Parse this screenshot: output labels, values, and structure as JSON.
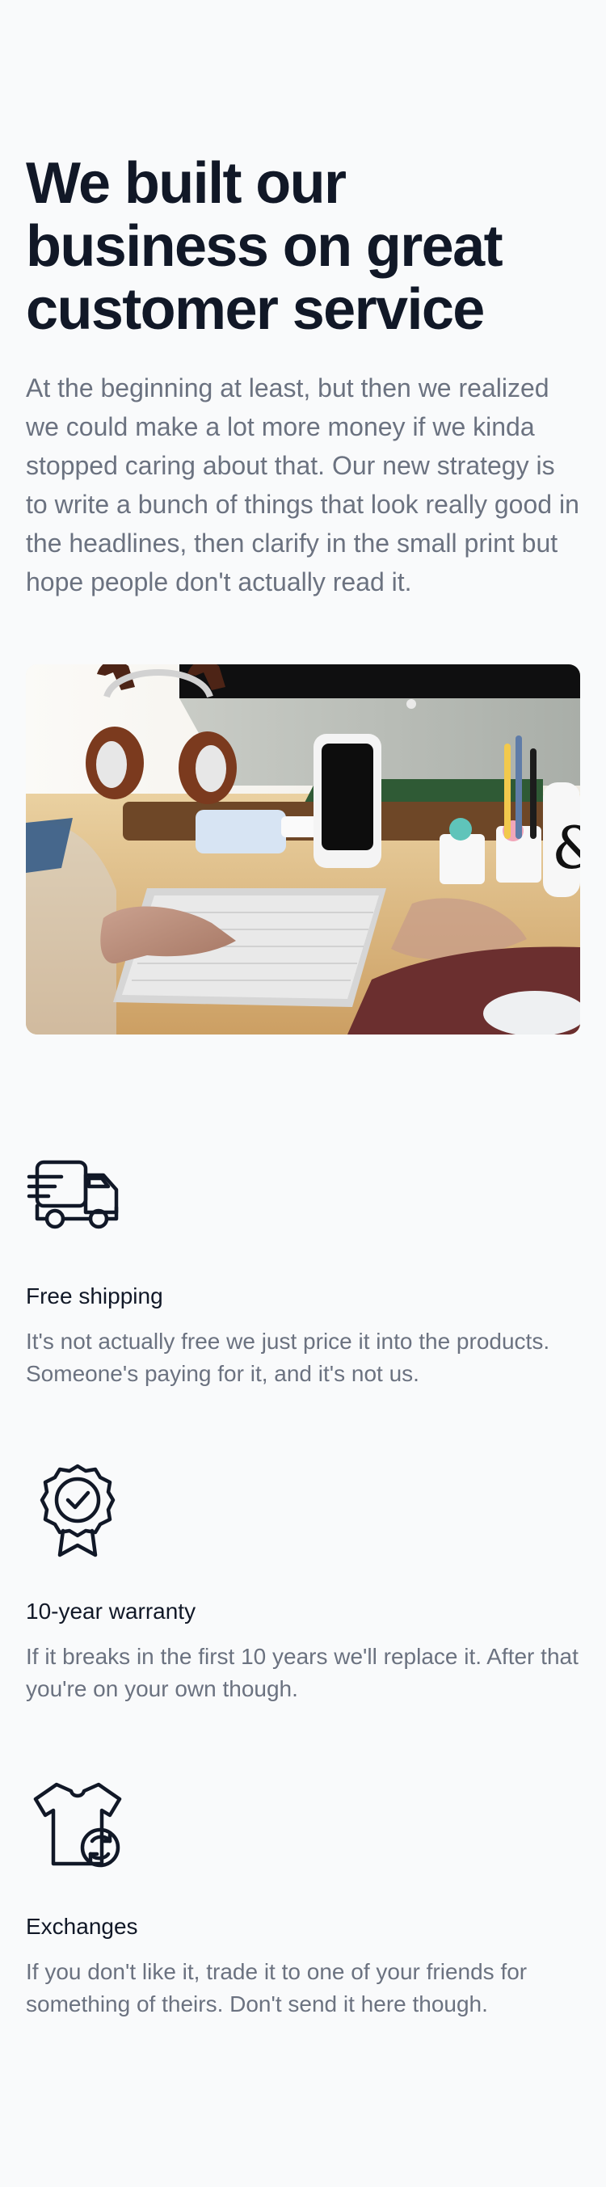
{
  "hero": {
    "title": "We built our business on great customer service",
    "description": "At the beginning at least, but then we realized we could make a lot more money if we kinda stopped caring about that. Our new strategy is to write a bunch of things that look really good in the headlines, then clarify in the small print but hope people don't actually read it."
  },
  "image": {
    "subject": "workspace-desk-photo",
    "colors": {
      "desk": "#d8b27b",
      "accent_dark": "#111111",
      "mat": "#6b2f2f"
    }
  },
  "features": [
    {
      "icon": "delivery-truck-icon",
      "title": "Free shipping",
      "description": "It's not actually free we just price it into the products. Someone's paying for it, and it's not us."
    },
    {
      "icon": "warranty-badge-icon",
      "title": "10-year warranty",
      "description": "If it breaks in the first 10 years we'll replace it. After that you're on your own though."
    },
    {
      "icon": "tshirt-exchange-icon",
      "title": "Exchanges",
      "description": "If you don't like it, trade it to one of your friends for something of theirs. Don't send it here though."
    }
  ],
  "colors": {
    "background": "#f9fafb",
    "heading": "#111827",
    "body_text": "#6b7280"
  }
}
